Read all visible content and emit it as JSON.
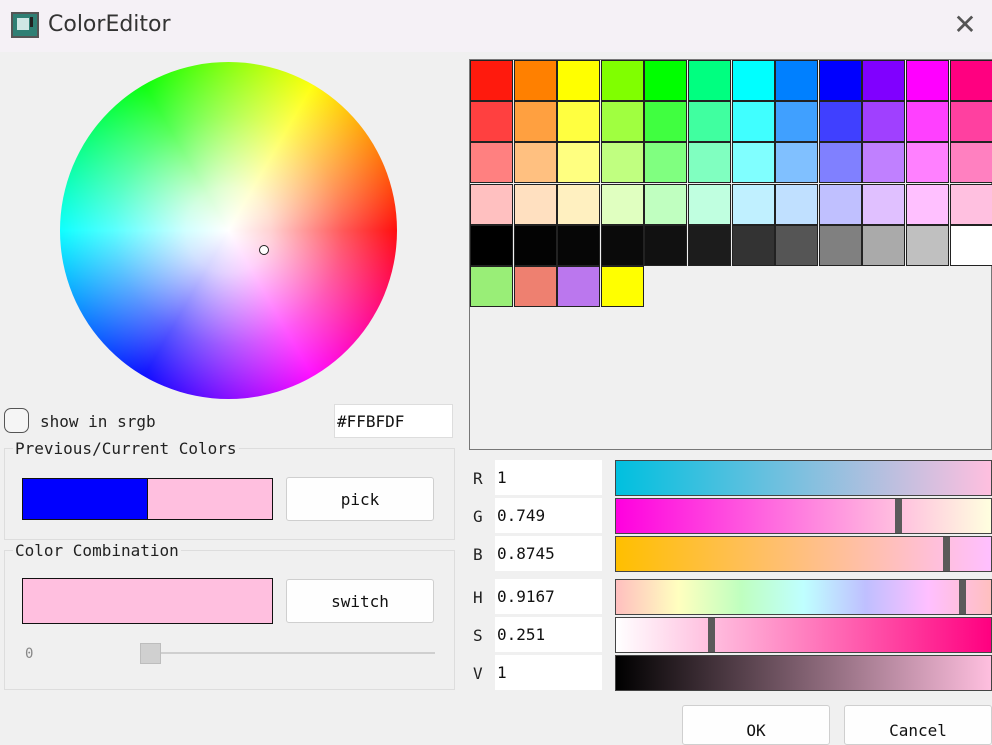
{
  "window": {
    "title": "ColorEditor"
  },
  "icons": {
    "app": "color-editor-app-icon",
    "close": "close-icon",
    "close_glyph": "✕"
  },
  "wheel": {
    "cursor_color": "#FFBFDF"
  },
  "srgb": {
    "label": "show in srgb",
    "checked": false
  },
  "hex": {
    "value": "#FFBFDF"
  },
  "previous_current": {
    "title": "Previous/Current Colors",
    "previous_color": "#0000FF",
    "current_color": "#FFBFDF",
    "pick_label": "pick"
  },
  "combination": {
    "title": "Color Combination",
    "swatch_color": "#FFBFDF",
    "switch_label": "switch",
    "slider_value": "0",
    "slider_fraction": 0.0
  },
  "palette": {
    "rows": [
      [
        "#ff1a0d",
        "#ff8000",
        "#ffff00",
        "#80ff00",
        "#00ff00",
        "#00ff80",
        "#00ffff",
        "#0080ff",
        "#0000ff",
        "#8000ff",
        "#ff00ff",
        "#ff0080"
      ],
      [
        "#ff4040",
        "#ffa040",
        "#ffff40",
        "#a0ff40",
        "#40ff40",
        "#40ffa0",
        "#40ffff",
        "#40a0ff",
        "#4040ff",
        "#a040ff",
        "#ff40ff",
        "#ff40a0"
      ],
      [
        "#ff8080",
        "#ffc080",
        "#ffff80",
        "#c0ff80",
        "#80ff80",
        "#80ffc0",
        "#80ffff",
        "#80c0ff",
        "#8080ff",
        "#c080ff",
        "#ff80ff",
        "#ff80c0"
      ],
      [
        "#ffc0c0",
        "#ffe0c0",
        "#fff0c0",
        "#e0ffc0",
        "#c0ffc0",
        "#c0ffe0",
        "#c0f0ff",
        "#c0e0ff",
        "#c0c0ff",
        "#e0c0ff",
        "#ffc0ff",
        "#ffc0e0"
      ],
      [
        "#000000",
        "#030303",
        "#060606",
        "#0a0a0a",
        "#111111",
        "#1c1c1c",
        "#333333",
        "#555555",
        "#808080",
        "#aaaaaa",
        "#c0c0c0",
        "#ffffff"
      ],
      [
        "#99ee77",
        "#ee8070",
        "#bb77ee",
        "#ffff00"
      ]
    ]
  },
  "channels": [
    {
      "label": "R",
      "value": "1",
      "fraction": 1.0,
      "gradient": "linear-gradient(to right, #00c0df, #ffbfdf)"
    },
    {
      "label": "G",
      "value": "0.749",
      "fraction": 0.749,
      "gradient": "linear-gradient(to right, #ff00df, #ffffdf)"
    },
    {
      "label": "B",
      "value": "0.8745",
      "fraction": 0.8745,
      "gradient": "linear-gradient(to right, #ffbf00, #ffbfff)"
    },
    {
      "label": "H",
      "value": "0.9167",
      "fraction": 0.9167,
      "gradient": "linear-gradient(to right, #ffbfbf, #ffffbf, #bfffbf, #bfffff, #bfbfff, #ffbfff, #ffbfbf)"
    },
    {
      "label": "S",
      "value": "0.251",
      "fraction": 0.251,
      "gradient": "linear-gradient(to right, #ffffff, #ff0080)"
    },
    {
      "label": "V",
      "value": "1",
      "fraction": 1.0,
      "gradient": "linear-gradient(to right, #000000, #ffbfdf)"
    }
  ],
  "buttons": {
    "ok": "OK",
    "cancel": "Cancel"
  }
}
